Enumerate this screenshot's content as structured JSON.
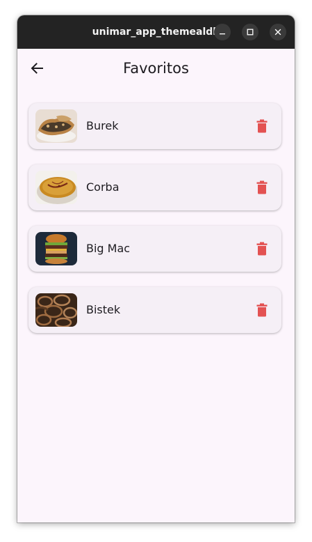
{
  "window": {
    "title": "unimar_app_themealdb",
    "controls": [
      "minimize-icon",
      "maximize-icon",
      "close-icon"
    ]
  },
  "appbar": {
    "back_icon": "arrow-back-icon",
    "title": "Favoritos"
  },
  "favorites": [
    {
      "name": "Burek",
      "icon": "delete-icon"
    },
    {
      "name": "Corba",
      "icon": "delete-icon"
    },
    {
      "name": "Big Mac",
      "icon": "delete-icon"
    },
    {
      "name": "Bistek",
      "icon": "delete-icon"
    }
  ],
  "colors": {
    "titlebar": "#232323",
    "background": "#fcf5fc",
    "card": "#f5eff6",
    "delete": "#e35252"
  }
}
